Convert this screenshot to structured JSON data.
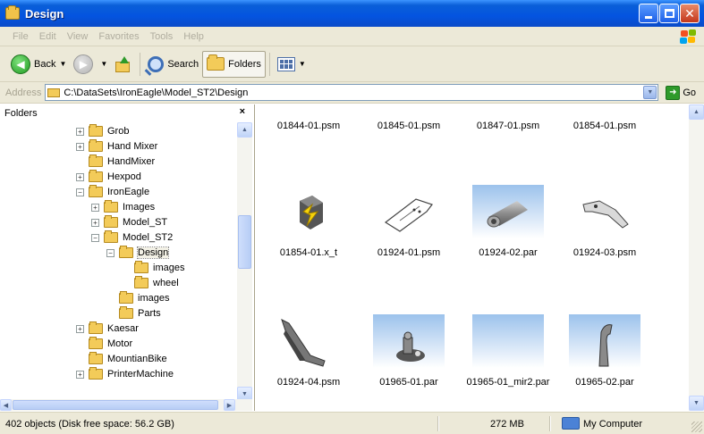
{
  "window": {
    "title": "Design"
  },
  "menu": [
    "File",
    "Edit",
    "View",
    "Favorites",
    "Tools",
    "Help"
  ],
  "toolbar": {
    "back": "Back",
    "search": "Search",
    "folders": "Folders"
  },
  "address": {
    "label": "Address",
    "path": "C:\\DataSets\\IronEagle\\Model_ST2\\Design",
    "go": "Go"
  },
  "folders_pane": {
    "title": "Folders",
    "close": "×",
    "items": [
      {
        "label": "Grob",
        "expander": "+"
      },
      {
        "label": "Hand Mixer",
        "expander": "+"
      },
      {
        "label": "HandMixer",
        "expander": ""
      },
      {
        "label": "Hexpod",
        "expander": "+"
      },
      {
        "label": "IronEagle",
        "expander": "−"
      },
      {
        "label": "Images",
        "expander": "+"
      },
      {
        "label": "Model_ST",
        "expander": "+"
      },
      {
        "label": "Model_ST2",
        "expander": "−"
      },
      {
        "label": "Design",
        "expander": "−"
      },
      {
        "label": "images",
        "expander": ""
      },
      {
        "label": "wheel",
        "expander": ""
      },
      {
        "label": "images",
        "expander": ""
      },
      {
        "label": "Parts",
        "expander": ""
      },
      {
        "label": "Kaesar",
        "expander": "+"
      },
      {
        "label": "Motor",
        "expander": ""
      },
      {
        "label": "MountianBike",
        "expander": ""
      },
      {
        "label": "PrinterMachine",
        "expander": "+"
      }
    ]
  },
  "files": [
    {
      "name": "01844-01.psm",
      "thumb": "none"
    },
    {
      "name": "01845-01.psm",
      "thumb": "none"
    },
    {
      "name": "01847-01.psm",
      "thumb": "none"
    },
    {
      "name": "01854-01.psm",
      "thumb": "none"
    },
    {
      "name": "01854-01.x_t",
      "thumb": "parasolid"
    },
    {
      "name": "01924-01.psm",
      "thumb": "sheet"
    },
    {
      "name": "01924-02.par",
      "thumb": "cylinder"
    },
    {
      "name": "01924-03.psm",
      "thumb": "bracket"
    },
    {
      "name": "01924-04.psm",
      "thumb": "blade"
    },
    {
      "name": "01965-01.par",
      "thumb": "assembly"
    },
    {
      "name": "01965-01_mir2.par",
      "thumb": "blank"
    },
    {
      "name": "01965-02.par",
      "thumb": "bent"
    }
  ],
  "status": {
    "objects": "402 objects (Disk free space: 56.2 GB)",
    "size": "272 MB",
    "location": "My Computer"
  }
}
